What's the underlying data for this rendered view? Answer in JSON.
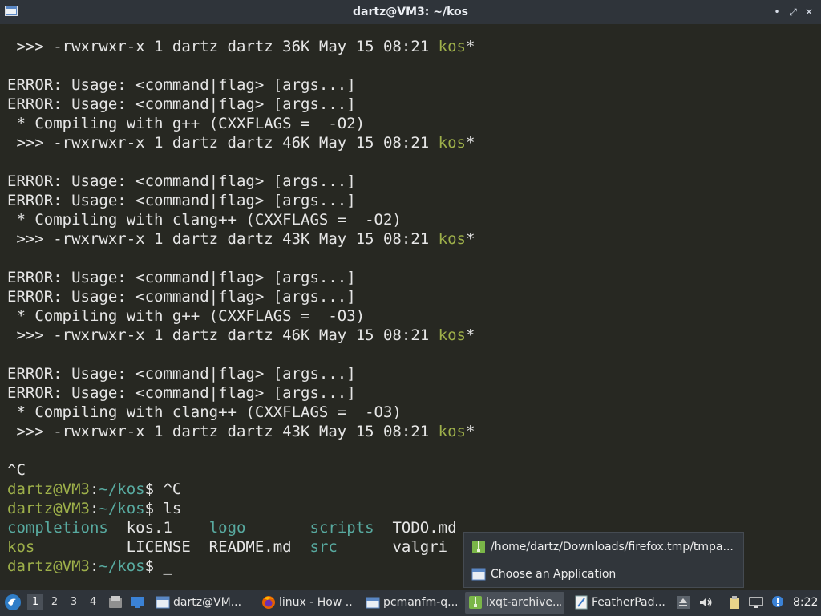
{
  "window": {
    "title": "dartz@VM3: ~/kos",
    "minimize_glyph": "•",
    "maximize_glyph": "⤢",
    "close_glyph": "✕"
  },
  "terminal": {
    "lines": [
      [
        [
          " >>> -rwxrwxr-x 1 dartz dartz 36K May 15 08:21 ",
          "c"
        ],
        [
          "kos",
          "g"
        ],
        [
          "*",
          "c"
        ]
      ],
      [
        [
          "",
          "c"
        ]
      ],
      [
        [
          "ERROR: Usage: <command|flag> [args...]",
          "c"
        ]
      ],
      [
        [
          "ERROR: Usage: <command|flag> [args...]",
          "c"
        ]
      ],
      [
        [
          " * Compiling with g++ (CXXFLAGS =  -O2)",
          "c"
        ]
      ],
      [
        [
          " >>> -rwxrwxr-x 1 dartz dartz 46K May 15 08:21 ",
          "c"
        ],
        [
          "kos",
          "g"
        ],
        [
          "*",
          "c"
        ]
      ],
      [
        [
          "",
          "c"
        ]
      ],
      [
        [
          "ERROR: Usage: <command|flag> [args...]",
          "c"
        ]
      ],
      [
        [
          "ERROR: Usage: <command|flag> [args...]",
          "c"
        ]
      ],
      [
        [
          " * Compiling with clang++ (CXXFLAGS =  -O2)",
          "c"
        ]
      ],
      [
        [
          " >>> -rwxrwxr-x 1 dartz dartz 43K May 15 08:21 ",
          "c"
        ],
        [
          "kos",
          "g"
        ],
        [
          "*",
          "c"
        ]
      ],
      [
        [
          "",
          "c"
        ]
      ],
      [
        [
          "ERROR: Usage: <command|flag> [args...]",
          "c"
        ]
      ],
      [
        [
          "ERROR: Usage: <command|flag> [args...]",
          "c"
        ]
      ],
      [
        [
          " * Compiling with g++ (CXXFLAGS =  -O3)",
          "c"
        ]
      ],
      [
        [
          " >>> -rwxrwxr-x 1 dartz dartz 46K May 15 08:21 ",
          "c"
        ],
        [
          "kos",
          "g"
        ],
        [
          "*",
          "c"
        ]
      ],
      [
        [
          "",
          "c"
        ]
      ],
      [
        [
          "ERROR: Usage: <command|flag> [args...]",
          "c"
        ]
      ],
      [
        [
          "ERROR: Usage: <command|flag> [args...]",
          "c"
        ]
      ],
      [
        [
          " * Compiling with clang++ (CXXFLAGS =  -O3)",
          "c"
        ]
      ],
      [
        [
          " >>> -rwxrwxr-x 1 dartz dartz 43K May 15 08:21 ",
          "c"
        ],
        [
          "kos",
          "g"
        ],
        [
          "*",
          "c"
        ]
      ],
      [
        [
          "",
          "c"
        ]
      ],
      [
        [
          "^C",
          "c"
        ]
      ],
      [
        [
          "dartz@VM3",
          "g"
        ],
        [
          ":",
          "c"
        ],
        [
          "~/kos",
          "t"
        ],
        [
          "$ ^C",
          "c"
        ]
      ],
      [
        [
          "dartz@VM3",
          "g"
        ],
        [
          ":",
          "c"
        ],
        [
          "~/kos",
          "t"
        ],
        [
          "$ ls",
          "c"
        ]
      ],
      [
        [
          "completions",
          "t"
        ],
        [
          "  kos.1    ",
          "c"
        ],
        [
          "logo",
          "t"
        ],
        [
          "       ",
          "c"
        ],
        [
          "scripts",
          "t"
        ],
        [
          "  TODO.md",
          "c"
        ]
      ],
      [
        [
          "kos",
          "g"
        ],
        [
          "          LICENSE  README.md  ",
          "c"
        ],
        [
          "src",
          "t"
        ],
        [
          "      valgri",
          "c"
        ]
      ],
      [
        [
          "dartz@VM3",
          "g"
        ],
        [
          ":",
          "c"
        ],
        [
          "~/kos",
          "t"
        ],
        [
          "$ _",
          "c"
        ]
      ]
    ]
  },
  "popup": {
    "items": [
      {
        "label": "/home/dartz/Downloads/firefox.tmp/tmpa...",
        "icon": "archive-icon"
      },
      {
        "label": "Choose an Application",
        "icon": "window-icon"
      }
    ]
  },
  "taskbar": {
    "workspaces": [
      "1",
      "2",
      "3",
      "4"
    ],
    "active_workspace": 0,
    "tasks": [
      {
        "label": "dartz@VM...",
        "icon": "terminal-icon"
      },
      {
        "label": "linux - How ...",
        "icon": "firefox-icon"
      },
      {
        "label": "pcmanfm-q...",
        "icon": "folder-icon"
      },
      {
        "label": "lxqt-archive...",
        "icon": "archive-icon",
        "active": true
      },
      {
        "label": "FeatherPad...",
        "icon": "text-editor-icon"
      }
    ],
    "clock": "8:22"
  },
  "colors": {
    "terminal_bg": "#272822",
    "terminal_fg": "#e6e6e6",
    "green": "#9eb04a",
    "teal": "#58aaa0",
    "panel_bg": "#2f343a"
  }
}
